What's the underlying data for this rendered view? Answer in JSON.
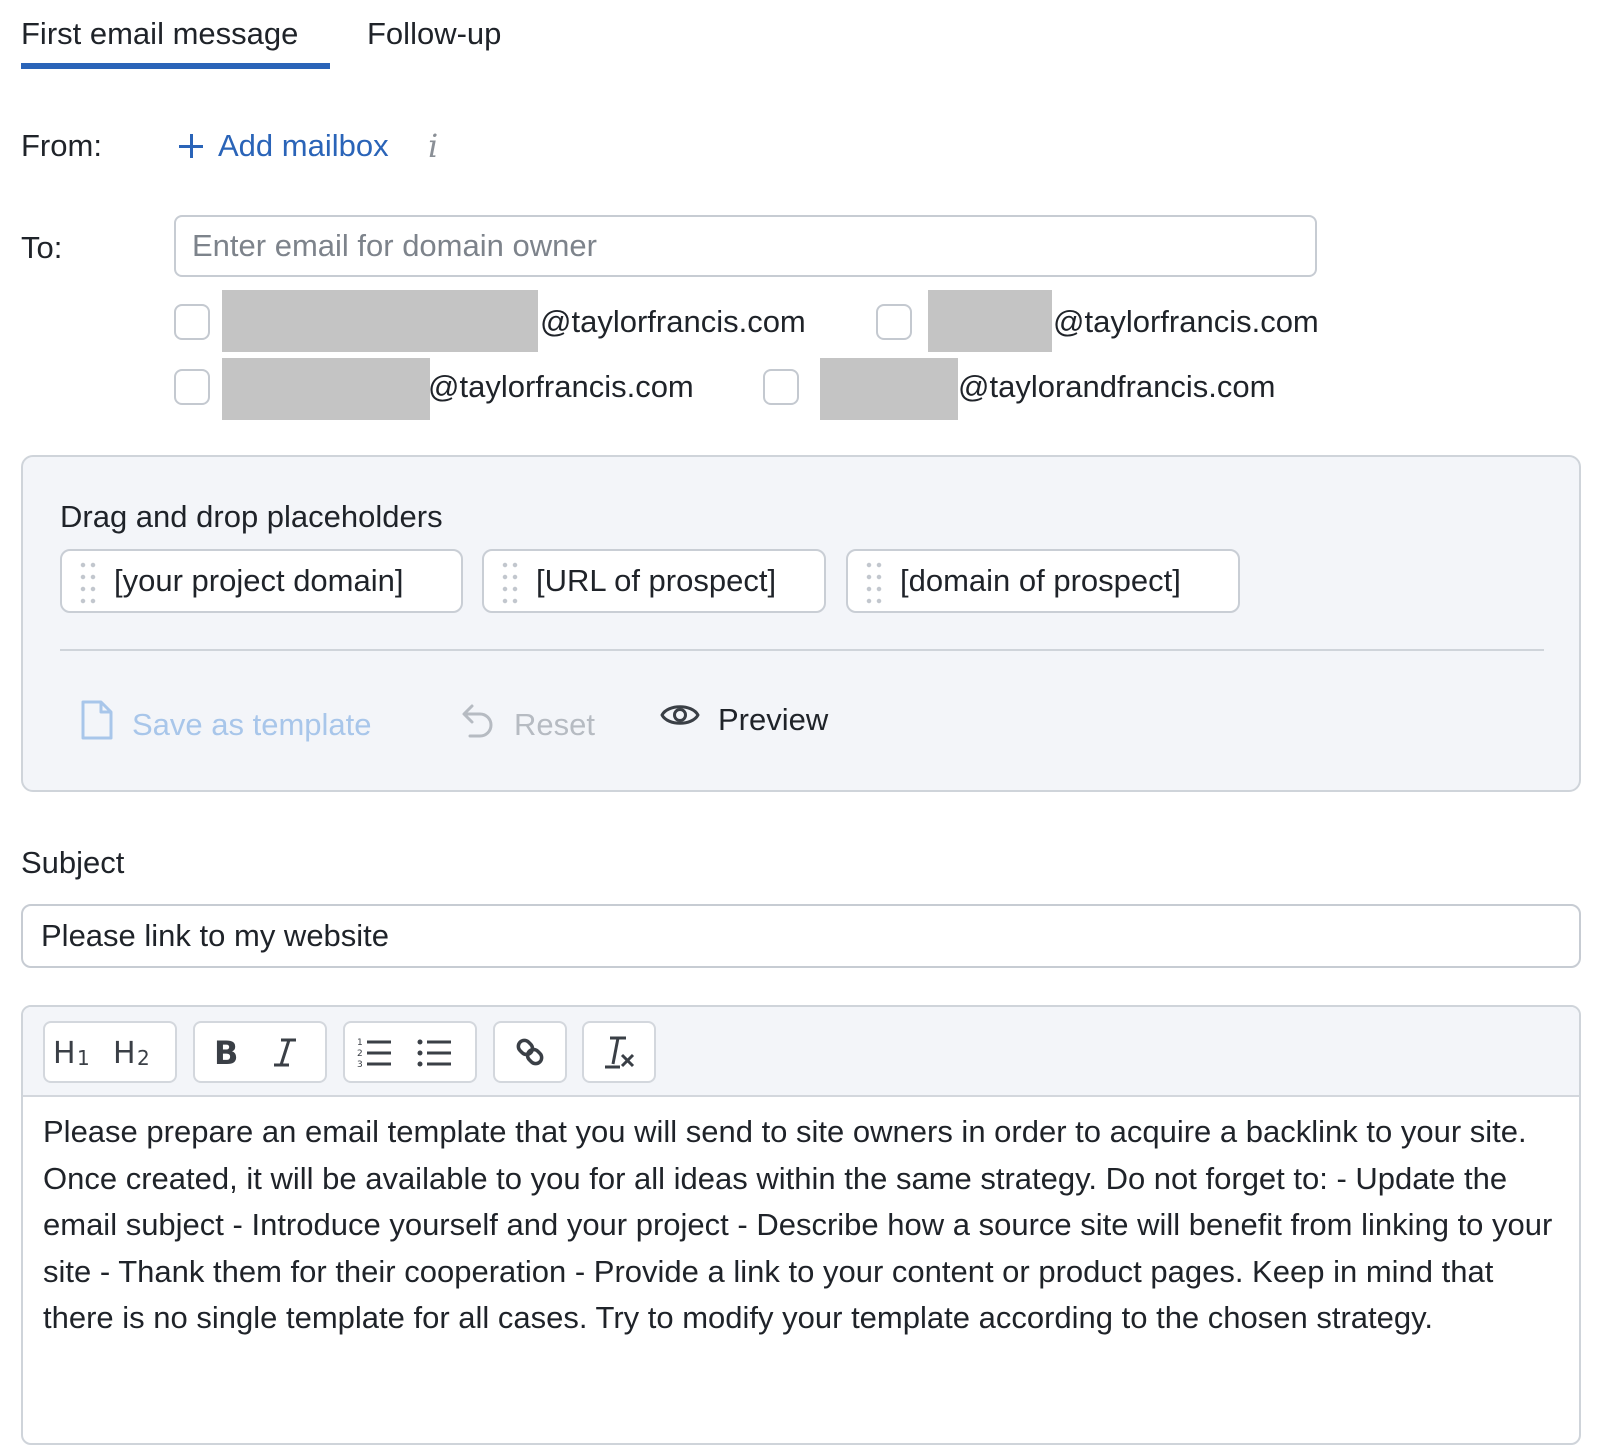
{
  "tabs": [
    {
      "label": "First email message",
      "active": true
    },
    {
      "label": "Follow-up",
      "active": false
    }
  ],
  "from": {
    "label": "From:",
    "add_mailbox_label": "Add mailbox",
    "info_icon": "info-icon"
  },
  "to": {
    "label": "To:",
    "placeholder": "Enter email for domain owner",
    "suggestions": [
      {
        "domain": "@taylorfrancis.com",
        "checked": false
      },
      {
        "domain": "@taylorfrancis.com",
        "checked": false
      },
      {
        "domain": "@taylorfrancis.com",
        "checked": false
      },
      {
        "domain": "@taylorandfrancis.com",
        "checked": false
      }
    ]
  },
  "placeholders_panel": {
    "title": "Drag and drop placeholders",
    "chips": [
      "[your project domain]",
      "[URL of prospect]",
      "[domain of prospect]"
    ],
    "actions": {
      "save_template": "Save as template",
      "reset": "Reset",
      "preview": "Preview"
    }
  },
  "subject": {
    "label": "Subject",
    "value": "Please link to my website"
  },
  "editor": {
    "toolbar": [
      "h1",
      "h2",
      "bold",
      "italic",
      "ordered-list",
      "bullet-list",
      "link",
      "clear-format"
    ],
    "body": "Please prepare an email template that you will send to site owners in order to acquire a backlink to your site. Once created, it will be available to you for all ideas within the same strategy. Do not forget to: - Update the email subject - Introduce yourself and your project - Describe how a source site will benefit from linking to your site - Thank them for their cooperation - Provide a link to your content or product pages. Keep in mind that there is no single template for all cases. Try to modify your template according to the chosen strategy."
  },
  "colors": {
    "accent": "#2a64b8",
    "panel_bg": "#f3f5f9",
    "disabled_link": "#a8c6ea",
    "redaction": "#c4c4c4"
  }
}
